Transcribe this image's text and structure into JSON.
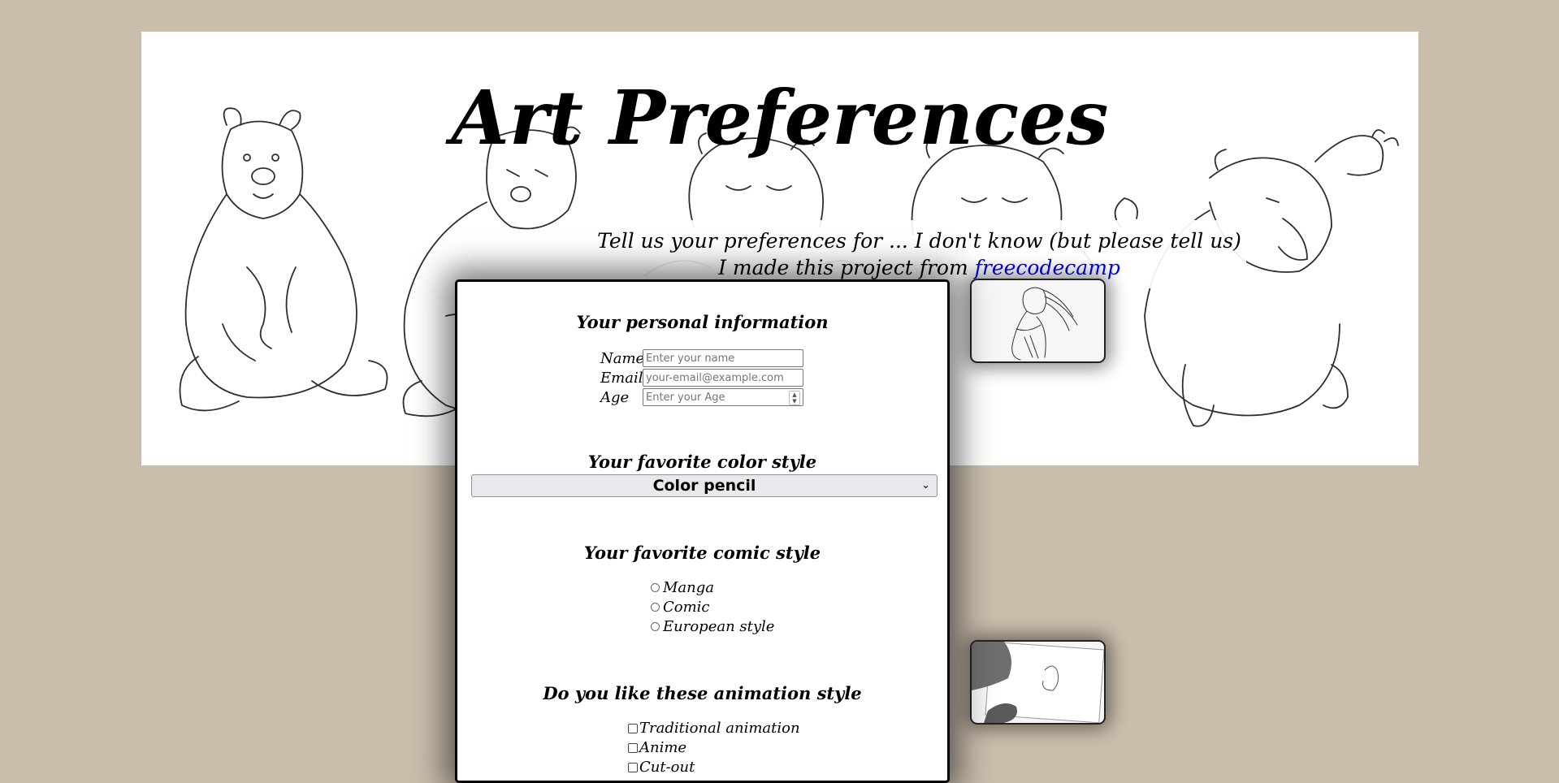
{
  "header": {
    "title": "Art Preferences",
    "tagline_text": "Tell us your preferences for ... I don't know (but please tell us) I made this project from ",
    "tagline_link": "freecodecamp"
  },
  "personal": {
    "heading": "Your personal information",
    "fields": [
      {
        "label": "Name",
        "placeholder": "Enter your name"
      },
      {
        "label": "Email",
        "placeholder": "your-email@example.com"
      },
      {
        "label": "Age",
        "placeholder": "Enter your Age"
      }
    ]
  },
  "color_style": {
    "heading": "Your favorite color style",
    "selected": "Color pencil"
  },
  "comic_style": {
    "heading": "Your favorite comic style",
    "options": [
      "Manga",
      "Comic",
      "European style"
    ]
  },
  "animation_style": {
    "heading": "Do you like these animation style",
    "options": [
      "Traditional animation",
      "Anime",
      "Cut-out"
    ]
  },
  "icons": {
    "select_arrow": "chevron-down-icon",
    "spinner": "number-spinner-icon"
  },
  "colors": {
    "page_background": "#c9bdac",
    "link": "#0000ee"
  }
}
